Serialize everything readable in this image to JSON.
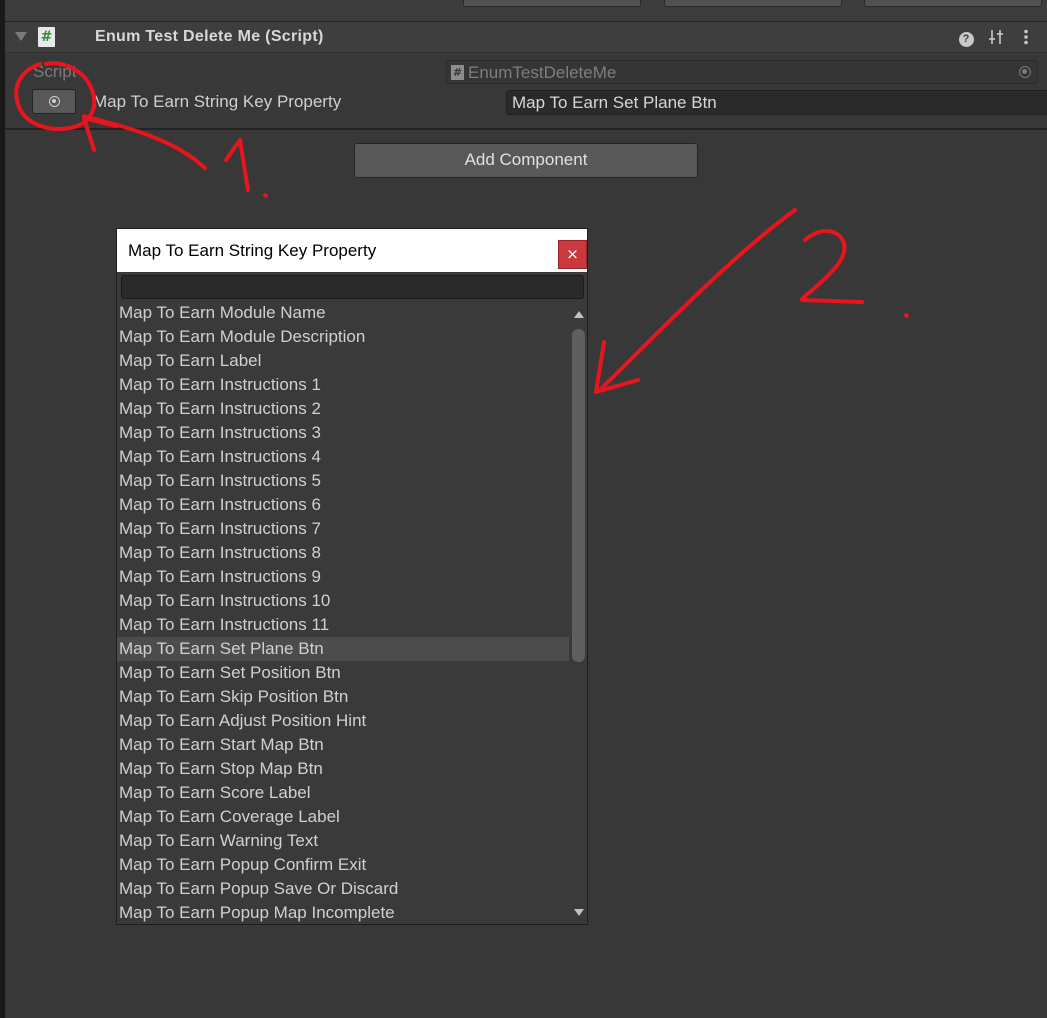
{
  "component": {
    "title": "Enum Test Delete Me (Script)",
    "script_label": "Script",
    "script_value": "EnumTestDeleteMe",
    "property_label": "Map To Earn String Key Property",
    "property_value": "Map To Earn Set Plane Btn"
  },
  "add_component_label": "Add Component",
  "popup": {
    "title": "Map To Earn String Key Property",
    "close_glyph": "×",
    "search_value": "",
    "selected_index": 14,
    "items": [
      "Map To Earn Module Name",
      "Map To Earn Module Description",
      "Map To Earn Label",
      "Map To Earn Instructions 1",
      "Map To Earn Instructions 2",
      "Map To Earn Instructions 3",
      "Map To Earn Instructions 4",
      "Map To Earn Instructions 5",
      "Map To Earn Instructions 6",
      "Map To Earn Instructions 7",
      "Map To Earn Instructions 8",
      "Map To Earn Instructions 9",
      "Map To Earn Instructions 10",
      "Map To Earn Instructions 11",
      "Map To Earn Set Plane Btn",
      "Map To Earn Set Position Btn",
      "Map To Earn Skip Position Btn",
      "Map To Earn Adjust Position Hint",
      "Map To Earn Start Map Btn",
      "Map To Earn Stop Map Btn",
      "Map To Earn Score Label",
      "Map To Earn Coverage Label",
      "Map To Earn Warning Text",
      "Map To Earn Popup Confirm Exit",
      "Map To Earn Popup Save Or Discard",
      "Map To Earn Popup Map Incomplete"
    ]
  },
  "annotation_color": "#e8141e",
  "icons": {
    "foldout": "triangle-down-icon",
    "script": "csharp-script-icon",
    "help": "help-icon",
    "presets": "sliders-icon",
    "menu": "kebab-menu-icon",
    "object_picker": "target-icon"
  }
}
